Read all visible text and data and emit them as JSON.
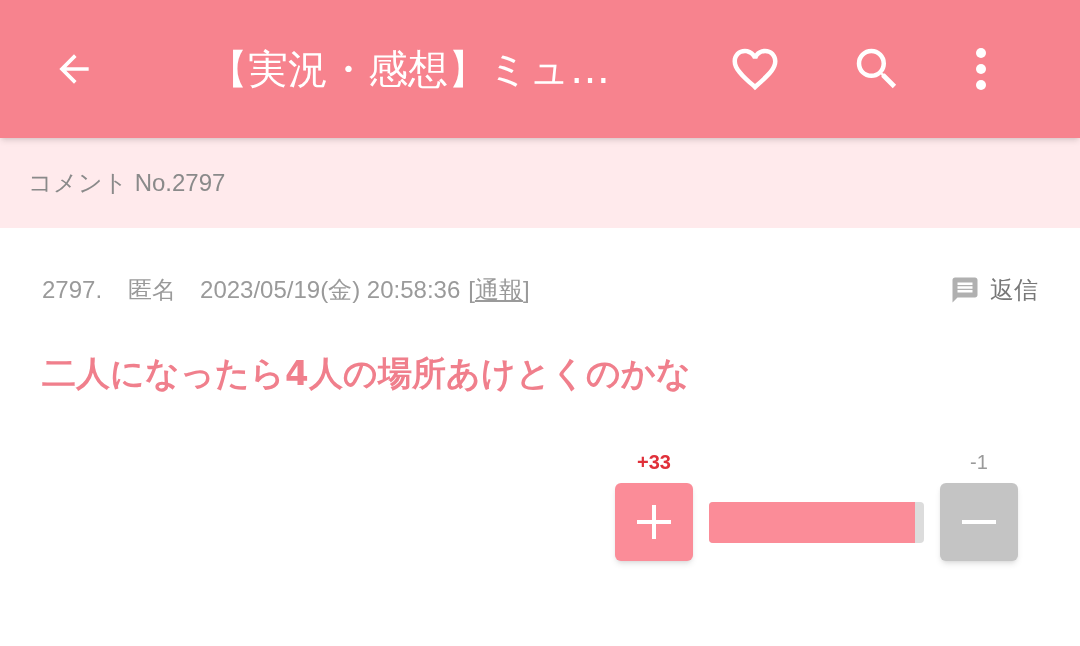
{
  "app_bar": {
    "title": "【実況・感想】ミュ…"
  },
  "subheader": {
    "text": "コメント No.2797"
  },
  "comment": {
    "number": "2797.",
    "author": "匿名",
    "date": "2023/05/19(金) 20:58:36",
    "report_open": "[",
    "report": "通報",
    "report_close": "]",
    "reply": "返信",
    "body": "二人になったら4人の場所あけとくのかな"
  },
  "votes": {
    "plus_count": "+33",
    "minus_count": "-1",
    "level": 0.96
  }
}
